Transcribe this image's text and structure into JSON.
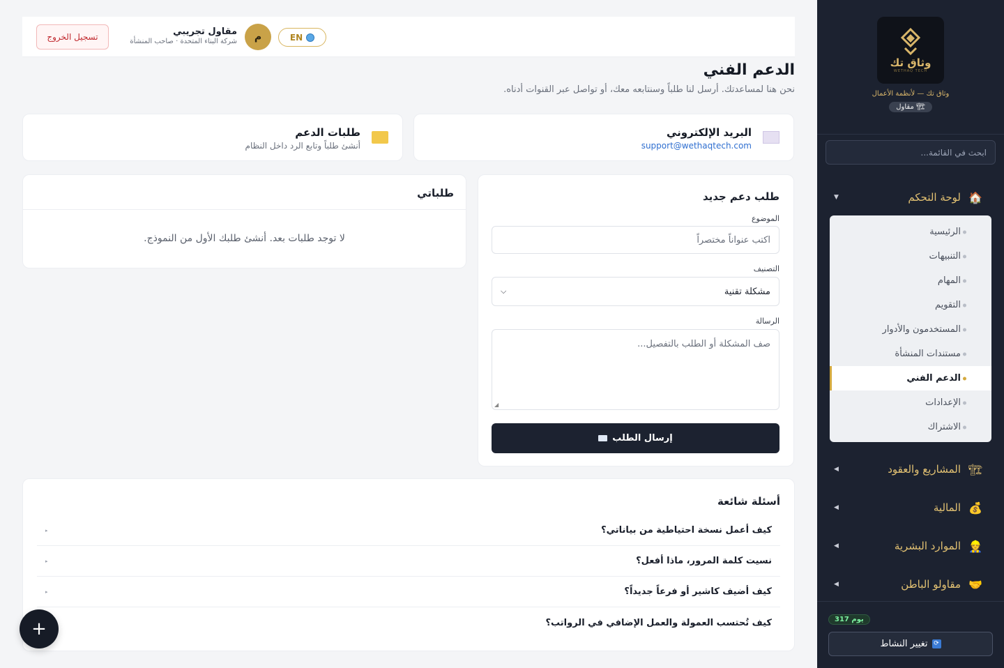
{
  "sidebar": {
    "logo_text": "وثاق تك",
    "logo_sub": "WETHAQ TECH",
    "tagline": "وثاق تك — لأنظمة الأعمال",
    "role_badge": "مقاول",
    "search_placeholder": "ابحث في القائمة...",
    "groups": [
      {
        "label": "لوحة التحكم",
        "icon": "house-icon",
        "glyph": "🏠",
        "caret": "▼"
      },
      {
        "label": "المشاريع والعقود",
        "icon": "crane-icon",
        "glyph": "🏗",
        "caret": "◀"
      },
      {
        "label": "المالية",
        "icon": "money-bag-icon",
        "glyph": "💰",
        "caret": "◀"
      },
      {
        "label": "الموارد البشرية",
        "icon": "worker-icon",
        "glyph": "👷",
        "caret": "◀"
      },
      {
        "label": "مقاولو الباطن",
        "icon": "handshake-icon",
        "glyph": "🤝",
        "caret": "◀"
      }
    ],
    "submenu": [
      "الرئيسية",
      "التنبيهات",
      "المهام",
      "التقويم",
      "المستخدمون والأدوار",
      "مستندات المنشأة",
      "الدعم الفني",
      "الإعدادات",
      "الاشتراك"
    ],
    "active_submenu": "الدعم الفني",
    "days_badge": "317 يوم",
    "switch_label": "تغيير النشاط"
  },
  "header": {
    "logout_label": "تسجيل الخروج",
    "user_name": "مقاول تجريبي",
    "user_sub": "شركة البناء المتحدة · صاحب المنشأة",
    "avatar_letter": "م",
    "lang_label": "EN"
  },
  "page": {
    "title": "الدعم الفني",
    "subtitle": "نحن هنا لمساعدتك. أرسل لنا طلباً وسنتابعه معك، أو تواصل عبر القنوات أدناه."
  },
  "contacts": {
    "email": {
      "title": "البريد الإلكتروني",
      "value": "support@wethaqtech.com"
    },
    "tickets": {
      "title": "طلبات الدعم",
      "value": "أنشئ طلباً وتابع الرد داخل النظام"
    }
  },
  "form": {
    "title": "طلب دعم جديد",
    "subject_label": "الموضوع",
    "subject_placeholder": "اكتب عنواناً مختصراً",
    "category_label": "التصنيف",
    "category_value": "مشكلة تقنية",
    "message_label": "الرسالة",
    "message_placeholder": "صف المشكلة أو الطلب بالتفصيل...",
    "submit_label": "إرسال الطلب"
  },
  "requests": {
    "title": "طلباتي",
    "empty": "لا توجد طلبات بعد. أنشئ طلبك الأول من النموذج."
  },
  "faq": {
    "title": "أسئلة شائعة",
    "items": [
      "كيف أعمل نسخة احتياطية من بياناتي؟",
      "نسيت كلمة المرور، ماذا أفعل؟",
      "كيف أضيف كاشير أو فرعاً جديداً؟",
      "كيف تُحتسب العمولة والعمل الإضافي في الرواتب؟"
    ]
  },
  "fab": {
    "label": "+"
  }
}
